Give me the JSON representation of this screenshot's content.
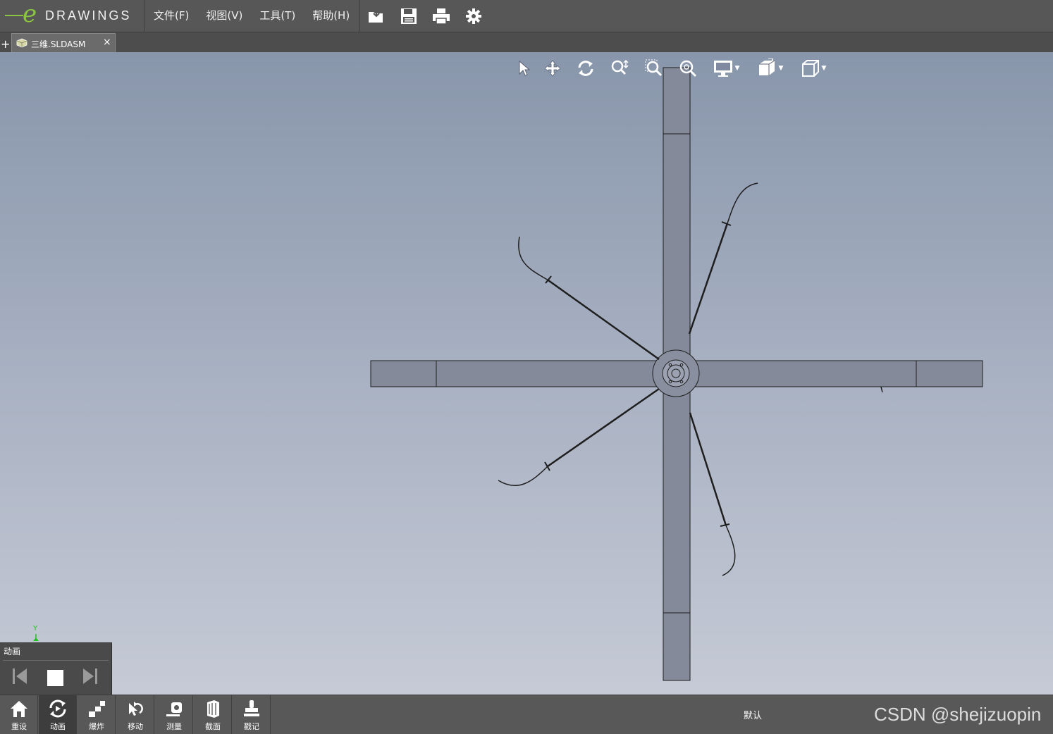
{
  "app": {
    "logo_text": "DRAWINGS",
    "logo_letter": "e"
  },
  "menu": [
    {
      "label": "文件(F)"
    },
    {
      "label": "视图(V)"
    },
    {
      "label": "工具(T)"
    },
    {
      "label": "帮助(H)"
    }
  ],
  "toolbar": [
    {
      "icon": "open-icon"
    },
    {
      "icon": "save-icon"
    },
    {
      "icon": "print-icon"
    },
    {
      "icon": "gear-icon"
    }
  ],
  "tab": {
    "plus": "+",
    "name": "三维.SLDASM",
    "close": "×"
  },
  "view_toolbar": [
    {
      "icon": "select-arrow-icon"
    },
    {
      "icon": "pan-icon"
    },
    {
      "icon": "rotate-icon"
    },
    {
      "icon": "zoom-icon"
    },
    {
      "icon": "zoom-window-icon"
    },
    {
      "icon": "zoom-fit-icon"
    },
    {
      "icon": "display-style-icon"
    },
    {
      "icon": "view-orientation-icon"
    },
    {
      "icon": "3d-view-icon"
    }
  ],
  "triad": {
    "y_label": "Y"
  },
  "animation": {
    "title": "动画"
  },
  "bottom_toolbar": [
    {
      "label": "重设",
      "icon": "home-icon"
    },
    {
      "label": "动画",
      "icon": "animation-icon"
    },
    {
      "label": "爆炸",
      "icon": "explode-icon"
    },
    {
      "label": "移动",
      "icon": "move-icon"
    },
    {
      "label": "测量",
      "icon": "measure-icon"
    },
    {
      "label": "截面",
      "icon": "section-icon"
    },
    {
      "label": "戳记",
      "icon": "stamp-icon"
    }
  ],
  "configuration": "默认",
  "watermark": "CSDN @shejizuopin",
  "colors": {
    "accent_green": "#8bc53f",
    "part_fill": "#858a9b"
  }
}
